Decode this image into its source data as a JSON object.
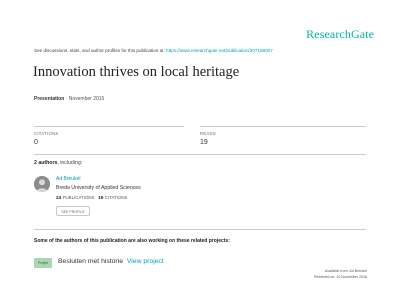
{
  "brand": {
    "name": "ResearchGate"
  },
  "header": {
    "discuss_text": "See discussions, stats, and author profiles for this publication at:",
    "discuss_link": "https://www.researchgate.net/publication/307168007"
  },
  "publication": {
    "title": "Innovation thrives on local heritage",
    "type": "Presentation",
    "separator": "·",
    "date": "November 2015"
  },
  "stats": {
    "citations_label": "CITATIONS",
    "citations_value": "0",
    "reads_label": "READS",
    "reads_value": "19"
  },
  "authors": {
    "count_label": "2 authors",
    "including": ", including:",
    "list": [
      {
        "name": "Ad Breukel",
        "institution": "Breda University of Applied Sciences",
        "publications_count": "24",
        "publications_label": "PUBLICATIONS",
        "citations_count": "19",
        "citations_label": "CITATIONS",
        "button_label": "SEE PROFILE"
      }
    ]
  },
  "related": {
    "heading": "Some of the authors of this publication are also working on these related projects:",
    "projects": [
      {
        "badge": "Project",
        "title": "Besluiten met historie",
        "link_label": "View project"
      }
    ]
  },
  "footer": {
    "available_from": "Available from: Ad Breukel",
    "retrieved_on": "Retrieved on: 10 November 2016"
  },
  "colors": {
    "brand": "#00b3a0",
    "link": "#00a2b5",
    "project_badge": "#a8d8b2",
    "rule": "#cccccc"
  }
}
